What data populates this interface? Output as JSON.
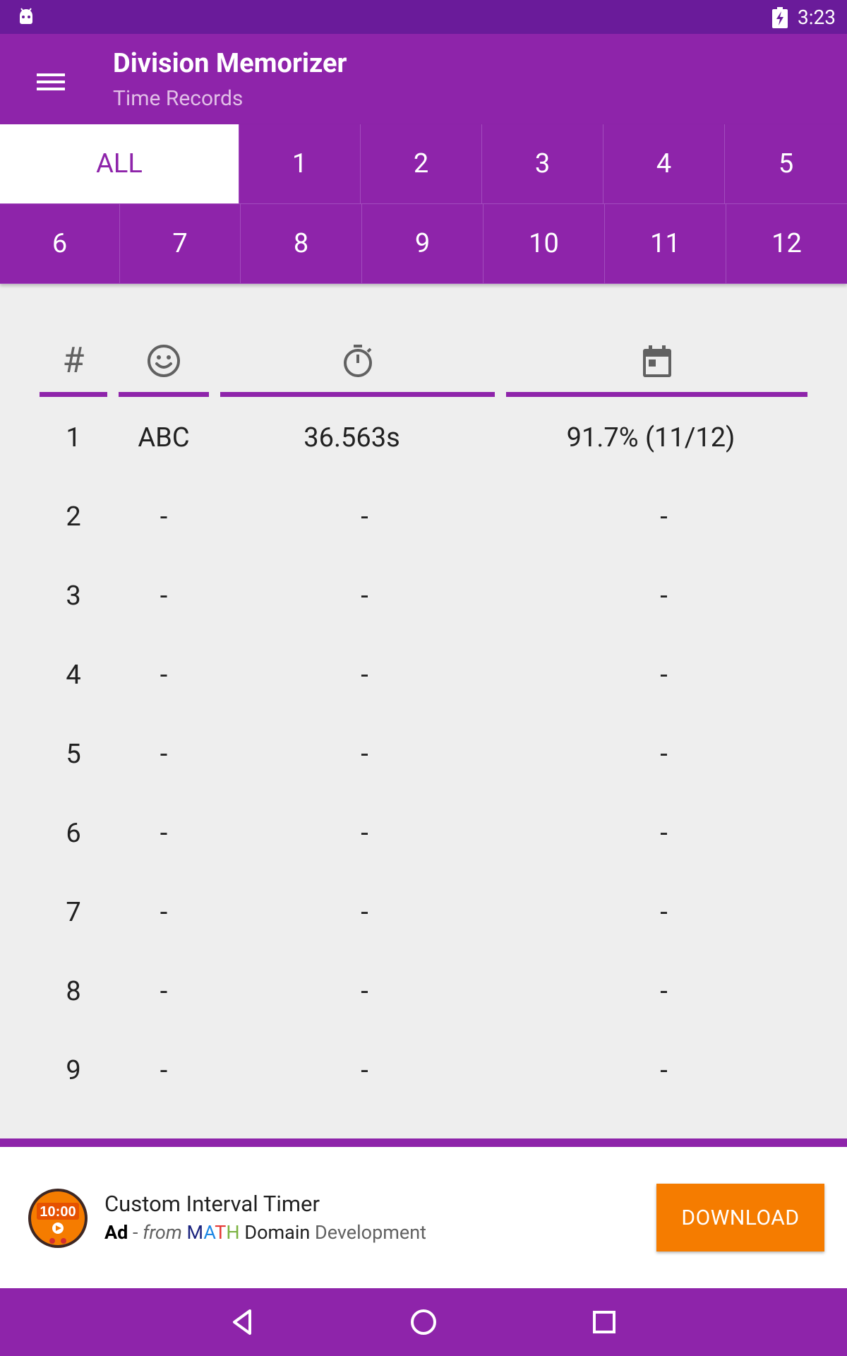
{
  "status_bar": {
    "time": "3:23"
  },
  "app_bar": {
    "title": "Division Memorizer",
    "subtitle": "Time Records"
  },
  "filters": {
    "row1": [
      "ALL",
      "1",
      "2",
      "3",
      "4",
      "5"
    ],
    "row2": [
      "6",
      "7",
      "8",
      "9",
      "10",
      "11",
      "12"
    ],
    "selected": "ALL"
  },
  "table": {
    "header": {
      "rank_symbol": "#"
    },
    "rows": [
      {
        "rank": "1",
        "name": "ABC",
        "time": "36.563s",
        "score": "91.7% (11/12)"
      },
      {
        "rank": "2",
        "name": "-",
        "time": "-",
        "score": "-"
      },
      {
        "rank": "3",
        "name": "-",
        "time": "-",
        "score": "-"
      },
      {
        "rank": "4",
        "name": "-",
        "time": "-",
        "score": "-"
      },
      {
        "rank": "5",
        "name": "-",
        "time": "-",
        "score": "-"
      },
      {
        "rank": "6",
        "name": "-",
        "time": "-",
        "score": "-"
      },
      {
        "rank": "7",
        "name": "-",
        "time": "-",
        "score": "-"
      },
      {
        "rank": "8",
        "name": "-",
        "time": "-",
        "score": "-"
      },
      {
        "rank": "9",
        "name": "-",
        "time": "-",
        "score": "-"
      }
    ]
  },
  "ad": {
    "icon_text": "10:00",
    "title": "Custom Interval Timer",
    "tag": "Ad",
    "separator": " - ",
    "from": "from",
    "brand_letters": [
      "M",
      "A",
      "T",
      "H"
    ],
    "brand_rest_1": "Domain",
    "brand_rest_2": "Development",
    "button": "DOWNLOAD"
  },
  "colors": {
    "primary": "#8e24aa",
    "primary_dark": "#6a1b9a",
    "accent": "#f57c00",
    "background": "#eeeeee"
  },
  "icons": [
    "android-icon",
    "battery-charging-icon",
    "menu-icon",
    "smiley-icon",
    "stopwatch-icon",
    "calendar-icon",
    "back-icon",
    "home-icon",
    "recents-icon"
  ]
}
